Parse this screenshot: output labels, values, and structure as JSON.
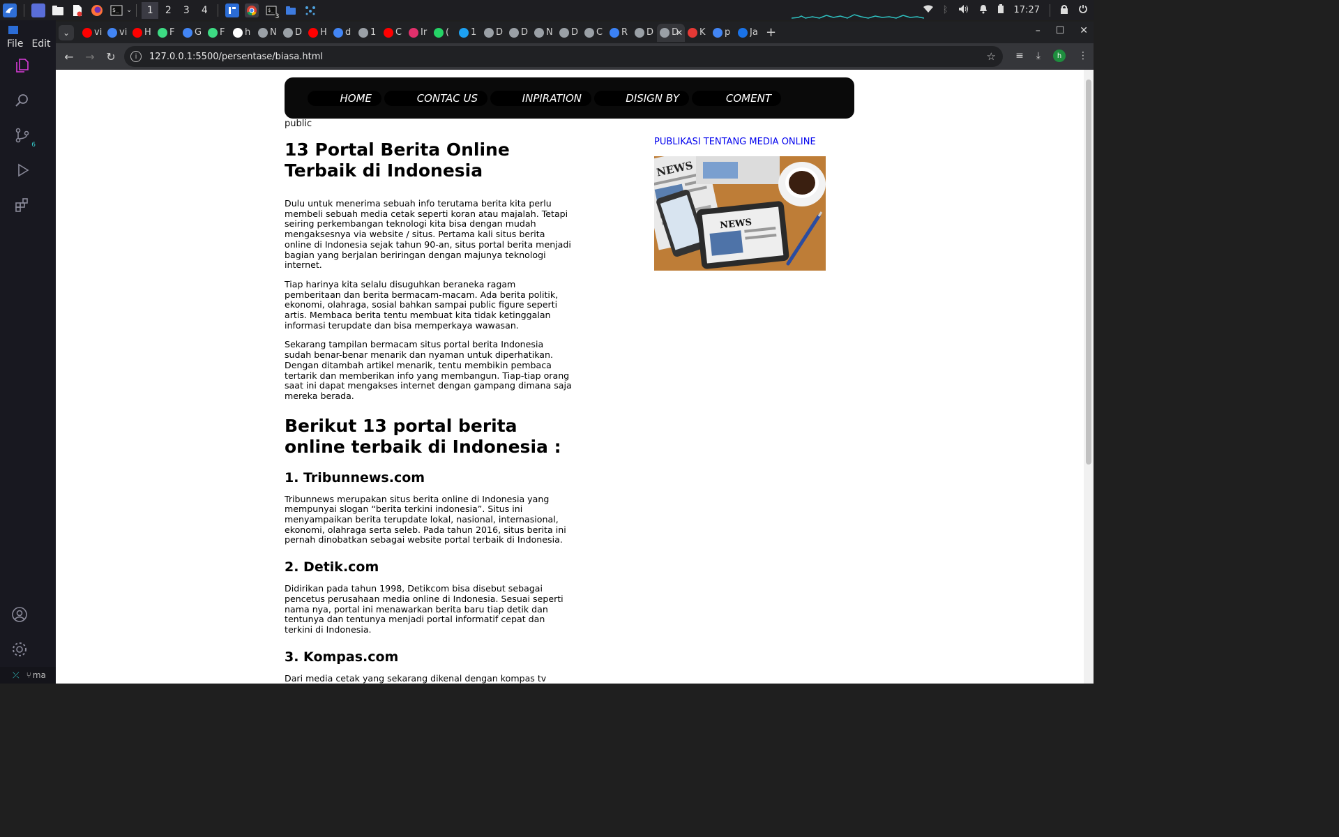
{
  "taskbar": {
    "workspaces": [
      "1",
      "2",
      "3",
      "4"
    ],
    "terminal_badge": "3",
    "clock": "17:27"
  },
  "vscode": {
    "menu": [
      "File",
      "Edit"
    ],
    "scm_badge": "6",
    "status_branch": "ma"
  },
  "browser": {
    "tabs": [
      {
        "title": "vi",
        "color": "#ff0000"
      },
      {
        "title": "vi",
        "color": "#4285f4"
      },
      {
        "title": "H",
        "color": "#ff0000"
      },
      {
        "title": "F",
        "color": "#3ddc84"
      },
      {
        "title": "G",
        "color": "#4285f4"
      },
      {
        "title": "F",
        "color": "#3ddc84"
      },
      {
        "title": "h",
        "color": "#ffffff"
      },
      {
        "title": "N",
        "color": "#9aa0a6"
      },
      {
        "title": "D",
        "color": "#9aa0a6"
      },
      {
        "title": "H",
        "color": "#ff0000"
      },
      {
        "title": "d",
        "color": "#4285f4"
      },
      {
        "title": "1",
        "color": "#9aa0a6"
      },
      {
        "title": "C",
        "color": "#ff0000"
      },
      {
        "title": "Ir",
        "color": "#e1306c"
      },
      {
        "title": "(",
        "color": "#25d366"
      },
      {
        "title": "1",
        "color": "#1da1f2"
      },
      {
        "title": "D",
        "color": "#9aa0a6"
      },
      {
        "title": "D",
        "color": "#9aa0a6"
      },
      {
        "title": "N",
        "color": "#9aa0a6"
      },
      {
        "title": "D",
        "color": "#9aa0a6"
      },
      {
        "title": "C",
        "color": "#9aa0a6"
      },
      {
        "title": "R",
        "color": "#3b82f6"
      },
      {
        "title": "D",
        "color": "#9aa0a6"
      },
      {
        "title": "D",
        "color": "#9aa0a6",
        "active": true
      },
      {
        "title": "K",
        "color": "#e53935"
      },
      {
        "title": "p",
        "color": "#4285f4"
      },
      {
        "title": "Ja",
        "color": "#1a73e8"
      }
    ],
    "url": "127.0.0.1:5500/persentase/biasa.html",
    "profile_initial": "h"
  },
  "page": {
    "nav": [
      "HOME",
      "CONTAC US",
      "INPIRATION",
      "DISIGN BY",
      "COMENT"
    ],
    "public_label": "public",
    "title": "13 Portal Berita Online Terbaik di Indonesia",
    "intro": [
      "Dulu untuk menerima sebuah info terutama berita kita perlu membeli sebuah media cetak seperti koran atau majalah. Tetapi seiring perkembangan teknologi kita bisa dengan mudah mengaksesnya via website / situs. Pertama kali situs berita online di Indonesia sejak tahun 90-an, situs portal berita menjadi bagian yang berjalan beriringan dengan majunya teknologi internet.",
      "Tiap harinya kita selalu disuguhkan beraneka ragam pemberitaan dan berita bermacam-macam. Ada berita politik, ekonomi, olahraga, sosial bahkan sampai public figure seperti artis. Membaca berita tentu membuat kita tidak ketinggalan informasi terupdate dan bisa memperkaya wawasan.",
      "Sekarang tampilan bermacam situs portal berita Indonesia sudah benar-benar menarik dan nyaman untuk diperhatikan. Dengan ditambah artikel menarik, tentu membikin pembaca tertarik dan memberikan info yang membangun. Tiap-tiap orang saat ini dapat mengakses internet dengan gampang dimana saja mereka berada."
    ],
    "list_heading": "Berikut 13 portal berita online terbaik di Indonesia :",
    "portals": [
      {
        "heading": "1. Tribunnews.com",
        "text": "Tribunnews merupakan situs berita online di Indonesia yang mempunyai slogan “berita terkini indonesia”. Situs ini menyampaikan berita terupdate lokal, nasional, internasional, ekonomi, olahraga serta seleb. Pada tahun 2016, situs berita ini pernah dinobatkan sebagai website portal terbaik di Indonesia."
      },
      {
        "heading": "2. Detik.com",
        "text": "Didirikan pada tahun 1998, Detikcom bisa disebut sebagai pencetus perusahaan media online di Indonesia. Sesuai seperti nama nya, portal ini menawarkan berita baru tiap detik dan tentunya dan tentunya menjadi portal informatif cepat dan terkini di Indonesia."
      },
      {
        "heading": "3. Kompas.com",
        "text": "Dari media cetak yang sekarang dikenal dengan kompas tv beralih ke portal web berita dengan alamat website kompas.com. Kompas.com selalu membagikan informasi yang terkait dengan dunia ekonomi, olahraga, teknologi, dan masih banyak lagi."
      }
    ],
    "sidebar_title": "PUBLIKASI TENTANG MEDIA ONLINE",
    "image_news_text_1": "NEWS",
    "image_news_text_2": "NEWS"
  }
}
